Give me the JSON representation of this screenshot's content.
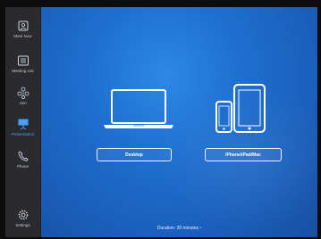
{
  "sidebar": {
    "items": [
      {
        "label": "Meet Now",
        "icon": "meet-now-icon"
      },
      {
        "label": "Meeting List",
        "icon": "meeting-list-icon"
      },
      {
        "label": "Join",
        "icon": "join-icon"
      },
      {
        "label": "Presentation",
        "icon": "presentation-icon",
        "active": true
      },
      {
        "label": "Phone",
        "icon": "phone-icon"
      },
      {
        "label": "Settings",
        "icon": "settings-icon"
      }
    ]
  },
  "main": {
    "options": [
      {
        "label": "Desktop",
        "icon": "laptop-icon"
      },
      {
        "label": "iPhone/iPad/Mac",
        "icon": "mobile-devices-icon"
      }
    ],
    "duration": "Duration: 30 minutes ›"
  },
  "colors": {
    "accent": "#4aa0ff",
    "background": "#1f6fd0",
    "sidebar": "#2b2b2e"
  }
}
